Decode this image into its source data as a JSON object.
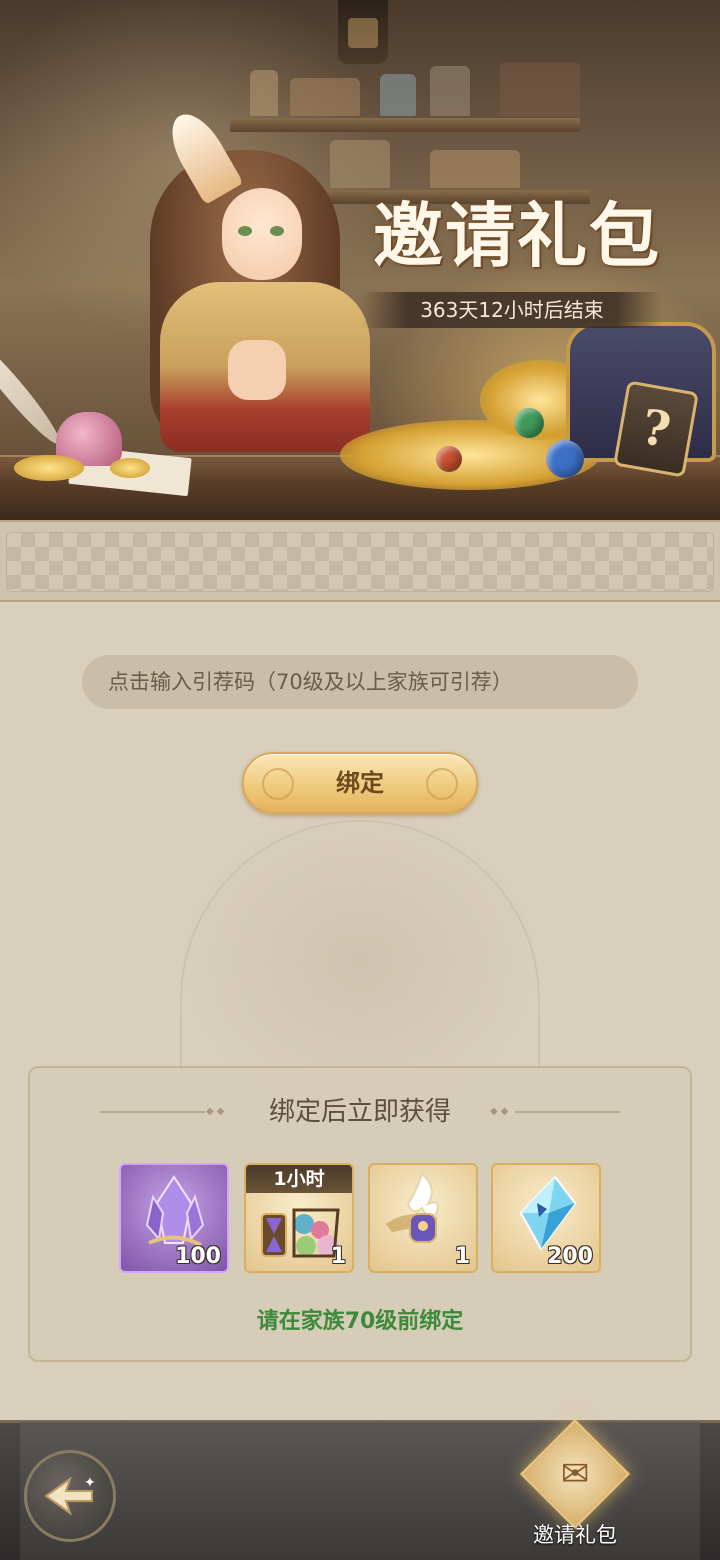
{
  "banner": {
    "title": "邀请礼包",
    "countdown": "363天12小时后结束",
    "mystery_glyph": "?"
  },
  "bind": {
    "input_placeholder": "点击输入引荐码（70级及以上家族可引荐）",
    "button_label": "绑定"
  },
  "rewards": {
    "title": "绑定后立即获得",
    "items": [
      {
        "icon": "purple-crystal-icon",
        "count": "100",
        "badge": ""
      },
      {
        "icon": "time-chest-icon",
        "count": "1",
        "badge": "1小时"
      },
      {
        "icon": "spirit-lamp-icon",
        "count": "1",
        "badge": ""
      },
      {
        "icon": "blue-diamond-icon",
        "count": "200",
        "badge": ""
      }
    ],
    "hint": "请在家族70级前绑定"
  },
  "nav": {
    "back_icon": "back-arrow-icon",
    "tab_label": "邀请礼包"
  },
  "colors": {
    "hint_green": "#3c8a3a",
    "button_gold": "#eecb7e",
    "panel_bg": "#d8cfbc"
  }
}
